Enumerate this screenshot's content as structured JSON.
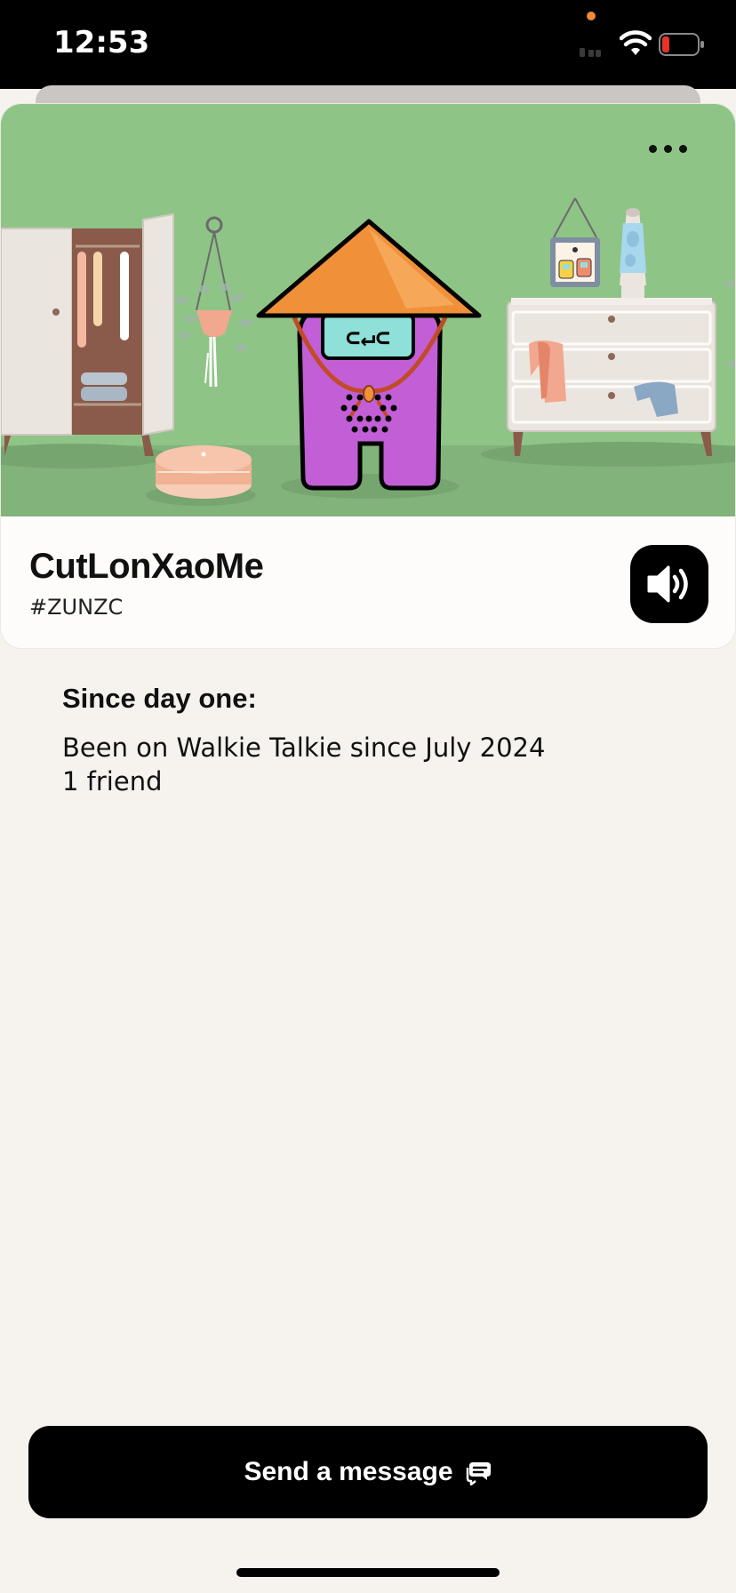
{
  "status_bar": {
    "time": "12:53"
  },
  "menu": {
    "more_icon": "ellipsis-icon"
  },
  "profile": {
    "name": "CutLonXaoMe",
    "tag": "#ZUNZC",
    "sound_icon": "speaker-icon"
  },
  "since": {
    "title": "Since day one:",
    "joined": "Been on Walkie Talkie since July 2024",
    "friends": "1 friend"
  },
  "actions": {
    "send_message_label": "Send a message",
    "send_message_icon": "chat-bubbles-icon"
  },
  "colors": {
    "scene_wall": "#8fc487",
    "avatar_body": "#c25fd6",
    "avatar_hat": "#f0913a",
    "button": "#000000",
    "background": "#f6f3ee"
  }
}
